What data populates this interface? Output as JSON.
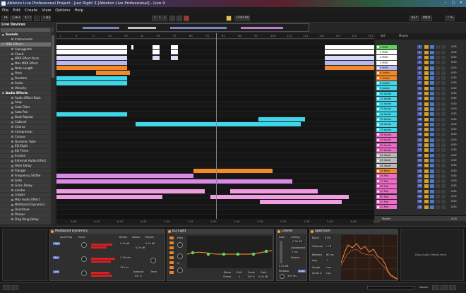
{
  "window": {
    "title": "Ableton Live Professional Project - Just Right 3 [Ableton Live Professional] - Live 9",
    "min": "–",
    "max": "□",
    "close": "✕"
  },
  "menu": [
    "File",
    "Edit",
    "Create",
    "View",
    "Options",
    "Help"
  ],
  "transport": {
    "tap": "TAP",
    "tempo": "128.00",
    "meter": "4 / 4",
    "quant": "1 Bar",
    "position": "1 . 1 . 1",
    "time": "0:00:00",
    "key": "KEY",
    "midi": "MIDI",
    "cpu": "7 %"
  },
  "browser": {
    "header": "Live Devices",
    "items": [
      {
        "label": "Sounds",
        "kind": "cat"
      },
      {
        "label": "Instruments",
        "kind": "item"
      },
      {
        "label": "MIDI Effects",
        "kind": "sel"
      },
      {
        "label": "Arpeggiator",
        "kind": "item"
      },
      {
        "label": "Chord",
        "kind": "item"
      },
      {
        "label": "MIDI Effect Rack",
        "kind": "item"
      },
      {
        "label": "Max MIDI Effect",
        "kind": "item"
      },
      {
        "label": "Note Length",
        "kind": "item"
      },
      {
        "label": "Pitch",
        "kind": "item"
      },
      {
        "label": "Random",
        "kind": "item"
      },
      {
        "label": "Scale",
        "kind": "item"
      },
      {
        "label": "Velocity",
        "kind": "item"
      },
      {
        "label": "Audio Effects",
        "kind": "cat"
      },
      {
        "label": "Audio Effect Rack",
        "kind": "item"
      },
      {
        "label": "Amp",
        "kind": "item"
      },
      {
        "label": "Auto Filter",
        "kind": "item"
      },
      {
        "label": "Auto Pan",
        "kind": "item"
      },
      {
        "label": "Beat Repeat",
        "kind": "item"
      },
      {
        "label": "Cabinet",
        "kind": "item"
      },
      {
        "label": "Chorus",
        "kind": "item"
      },
      {
        "label": "Compressor",
        "kind": "item"
      },
      {
        "label": "Corpus",
        "kind": "item"
      },
      {
        "label": "Dynamic Tube",
        "kind": "item"
      },
      {
        "label": "EQ Eight",
        "kind": "item"
      },
      {
        "label": "EQ Three",
        "kind": "item"
      },
      {
        "label": "Erosion",
        "kind": "item"
      },
      {
        "label": "External Audio Effect",
        "kind": "item"
      },
      {
        "label": "Filter Delay",
        "kind": "item"
      },
      {
        "label": "Flanger",
        "kind": "item"
      },
      {
        "label": "Frequency Shifter",
        "kind": "item"
      },
      {
        "label": "Gate",
        "kind": "item"
      },
      {
        "label": "Grain Delay",
        "kind": "item"
      },
      {
        "label": "Limiter",
        "kind": "item"
      },
      {
        "label": "Looper",
        "kind": "item"
      },
      {
        "label": "Max Audio Effect",
        "kind": "item"
      },
      {
        "label": "Multiband Dynamics",
        "kind": "item"
      },
      {
        "label": "Overdrive",
        "kind": "item"
      },
      {
        "label": "Phaser",
        "kind": "item"
      },
      {
        "label": "Ping Pong Delay",
        "kind": "item"
      }
    ]
  },
  "ruler": [
    "1",
    "9",
    "17",
    "25",
    "33",
    "41",
    "49",
    "57",
    "65",
    "73",
    "81",
    "89",
    "97",
    "105",
    "113",
    "121",
    "129",
    "137",
    "145",
    "153"
  ],
  "loop_ruler": [
    "0:00",
    "0:15",
    "0:30",
    "0:45",
    "1:00",
    "1:15",
    "1:30",
    "1:45",
    "2:00",
    "2:15",
    "2:30",
    "2:45",
    "3:00",
    "3:15"
  ],
  "tracks_header": {
    "set": "Set",
    "master": "Master"
  },
  "tracks": [
    {
      "name": "1 MIDI",
      "color": "#5fd35f",
      "num": "1"
    },
    {
      "name": "2 MIDI",
      "color": "#ffffff",
      "num": "2"
    },
    {
      "name": "3 MIDI",
      "color": "#ffffff",
      "num": "3"
    },
    {
      "name": "4 MIDI",
      "color": "#ffffff",
      "num": "4"
    },
    {
      "name": "5 MIDI",
      "color": "#b8b8f0",
      "num": "5"
    },
    {
      "name": "6 Audio",
      "color": "#f08a2a",
      "num": "6"
    },
    {
      "name": "7 Audio",
      "color": "#f08a2a",
      "num": "7"
    },
    {
      "name": "8 Audio",
      "color": "#3ed6e8",
      "num": "8"
    },
    {
      "name": "9 Audio",
      "color": "#3ed6e8",
      "num": "9"
    },
    {
      "name": "10 Audio",
      "color": "#3ed6e8",
      "num": "10"
    },
    {
      "name": "11 Audio",
      "color": "#3ed6e8",
      "num": "11"
    },
    {
      "name": "12 Audio",
      "color": "#3ed6e8",
      "num": "12"
    },
    {
      "name": "13 Audio",
      "color": "#3ed6e8",
      "num": "13"
    },
    {
      "name": "14 Audio",
      "color": "#3ed6e8",
      "num": "14"
    },
    {
      "name": "15 Audio",
      "color": "#3ed6e8",
      "num": "15"
    },
    {
      "name": "16 Audio",
      "color": "#3ed6e8",
      "num": "16"
    },
    {
      "name": "17 Audio",
      "color": "#3ed6e8",
      "num": "17"
    },
    {
      "name": "18 Audio",
      "color": "#ef6cc8",
      "num": "18"
    },
    {
      "name": "19 Audio",
      "color": "#ef6cc8",
      "num": "19"
    },
    {
      "name": "20 Audio",
      "color": "#ef6cc8",
      "num": "20"
    },
    {
      "name": "21 Audio",
      "color": "#ef6cc8",
      "num": "21"
    },
    {
      "name": "22 Vocal",
      "color": "#b9b9b9",
      "num": "22"
    },
    {
      "name": "23 Vocal",
      "color": "#b9b9b9",
      "num": "23"
    },
    {
      "name": "24 Vocal",
      "color": "#b9b9b9",
      "num": "24"
    },
    {
      "name": "25 Bass",
      "color": "#f08a2a",
      "num": "25"
    },
    {
      "name": "26 Pad",
      "color": "#ef6cc8",
      "num": "26"
    },
    {
      "name": "27 Pad",
      "color": "#ef6cc8",
      "num": "27"
    },
    {
      "name": "28 Pad",
      "color": "#ef6cc8",
      "num": "28"
    },
    {
      "name": "29 Pad",
      "color": "#ef6cc8",
      "num": "29"
    },
    {
      "name": "30 Pad",
      "color": "#ef6cc8",
      "num": "30"
    },
    {
      "name": "31 Pad",
      "color": "#ef6cc8",
      "num": "31"
    },
    {
      "name": "32 Pad",
      "color": "#ef6cc8",
      "num": "32"
    }
  ],
  "master": {
    "label": "Master",
    "value": "0.00"
  },
  "devices": {
    "multiband": {
      "title": "Multiband Dynamics",
      "split": "Split Freq",
      "input": "Input",
      "high": "High",
      "mid": "Mid",
      "low": "Low",
      "below": "Below",
      "above": "Above",
      "output": "Output",
      "amount": "Amount",
      "time": "Time",
      "v1": "0.00 dB",
      "v2": "0.00 dB",
      "v3": "0.00 dB",
      "v4": "2.50 kHz",
      "v5": "120 Hz",
      "v6": "100 %"
    },
    "eq": {
      "title": "EQ Eight",
      "mode": "Mode",
      "edit": "Edit",
      "scale": "Scale",
      "gain": "Gain",
      "m1": "Stereo",
      "m2": "A",
      "m3": "100 %",
      "m4": "0.00 dB",
      "freq": "Freq",
      "q": "Q"
    },
    "limiter": {
      "title": "Limiter",
      "gain": "Gain",
      "ceiling": "Ceiling",
      "lookahead": "Lookahead",
      "release": "Release",
      "auto": "Auto",
      "stereo": "Stereo",
      "g": "0.00 dB",
      "c": "-0.30 dB",
      "l": "3 ms",
      "r": "300 ms"
    },
    "spectrum": {
      "title": "Spectrum",
      "block": "Block",
      "channel": "Channel",
      "refresh": "Refresh",
      "avg": "Avg",
      "graph": "Graph",
      "scale_x": "Scale X",
      "bv": "8192",
      "cv": "L+R",
      "rv": "60 ms",
      "av": "1",
      "gv": "Line",
      "sv": "Log"
    },
    "drop": "Drop Audio Effects Here"
  },
  "status": {
    "track": "Master"
  }
}
